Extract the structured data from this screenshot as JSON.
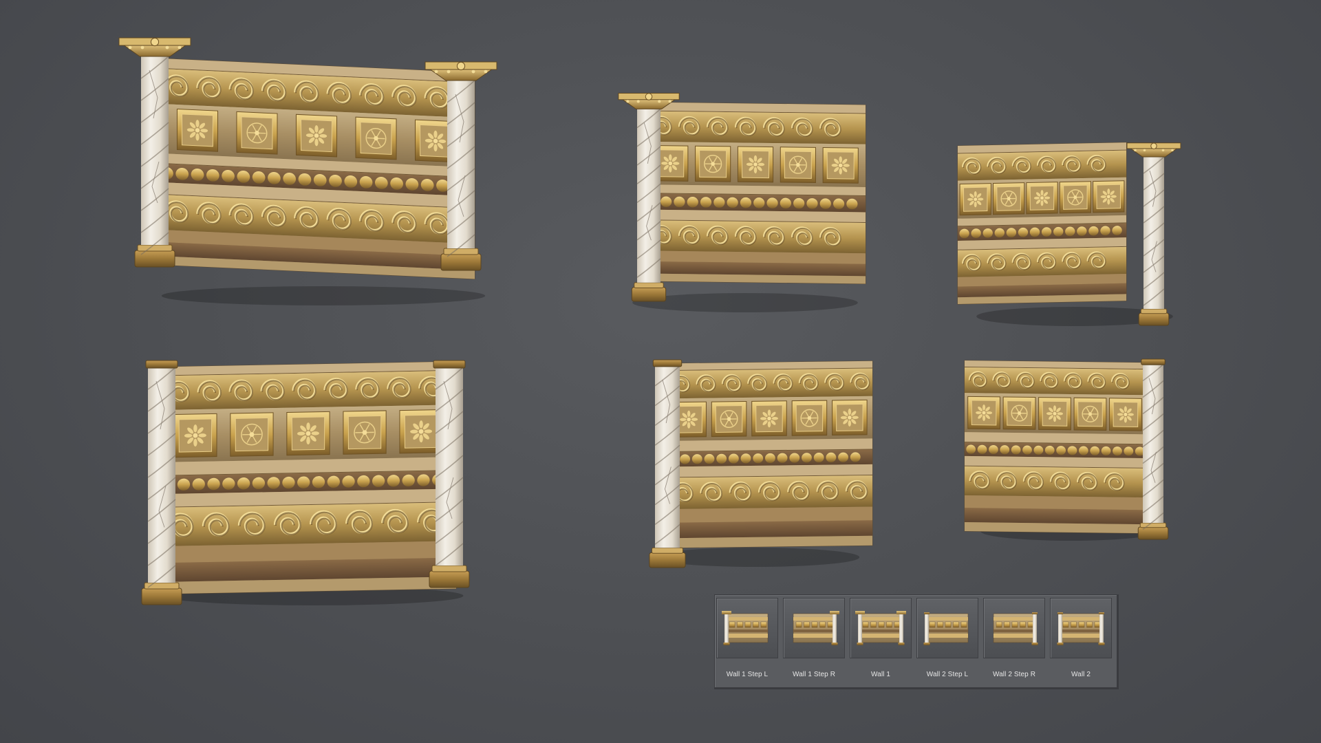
{
  "viewport": {
    "background": "#4d4f53",
    "previews": [
      {
        "name": "wall-1",
        "style": "wall1"
      },
      {
        "name": "wall-1-step-r",
        "style": "wall1"
      },
      {
        "name": "wall-1-step-l",
        "style": "wall1"
      },
      {
        "name": "wall-2",
        "style": "wall2"
      },
      {
        "name": "wall-2-step-r",
        "style": "wall2"
      },
      {
        "name": "wall-2-step-l",
        "style": "wall2"
      }
    ]
  },
  "palette": {
    "gold": "#c9a24e",
    "gold_dark": "#7d5e2a",
    "stone": "#b7a27a",
    "stone_dark": "#8c7550",
    "marble": "#e8e2d6",
    "marble_vein": "#8a8074",
    "base_bronze": "#a4803f"
  },
  "thumbnails": [
    {
      "label": "Wall 1 Step L",
      "icon": "wall-capital-left-icon"
    },
    {
      "label": "Wall 1 Step R",
      "icon": "wall-capital-right-icon"
    },
    {
      "label": "Wall 1",
      "icon": "wall-capital-both-icon"
    },
    {
      "label": "Wall 2 Step L",
      "icon": "wall-column-left-icon"
    },
    {
      "label": "Wall 2 Step R",
      "icon": "wall-column-right-icon"
    },
    {
      "label": "Wall 2",
      "icon": "wall-column-both-icon"
    }
  ]
}
